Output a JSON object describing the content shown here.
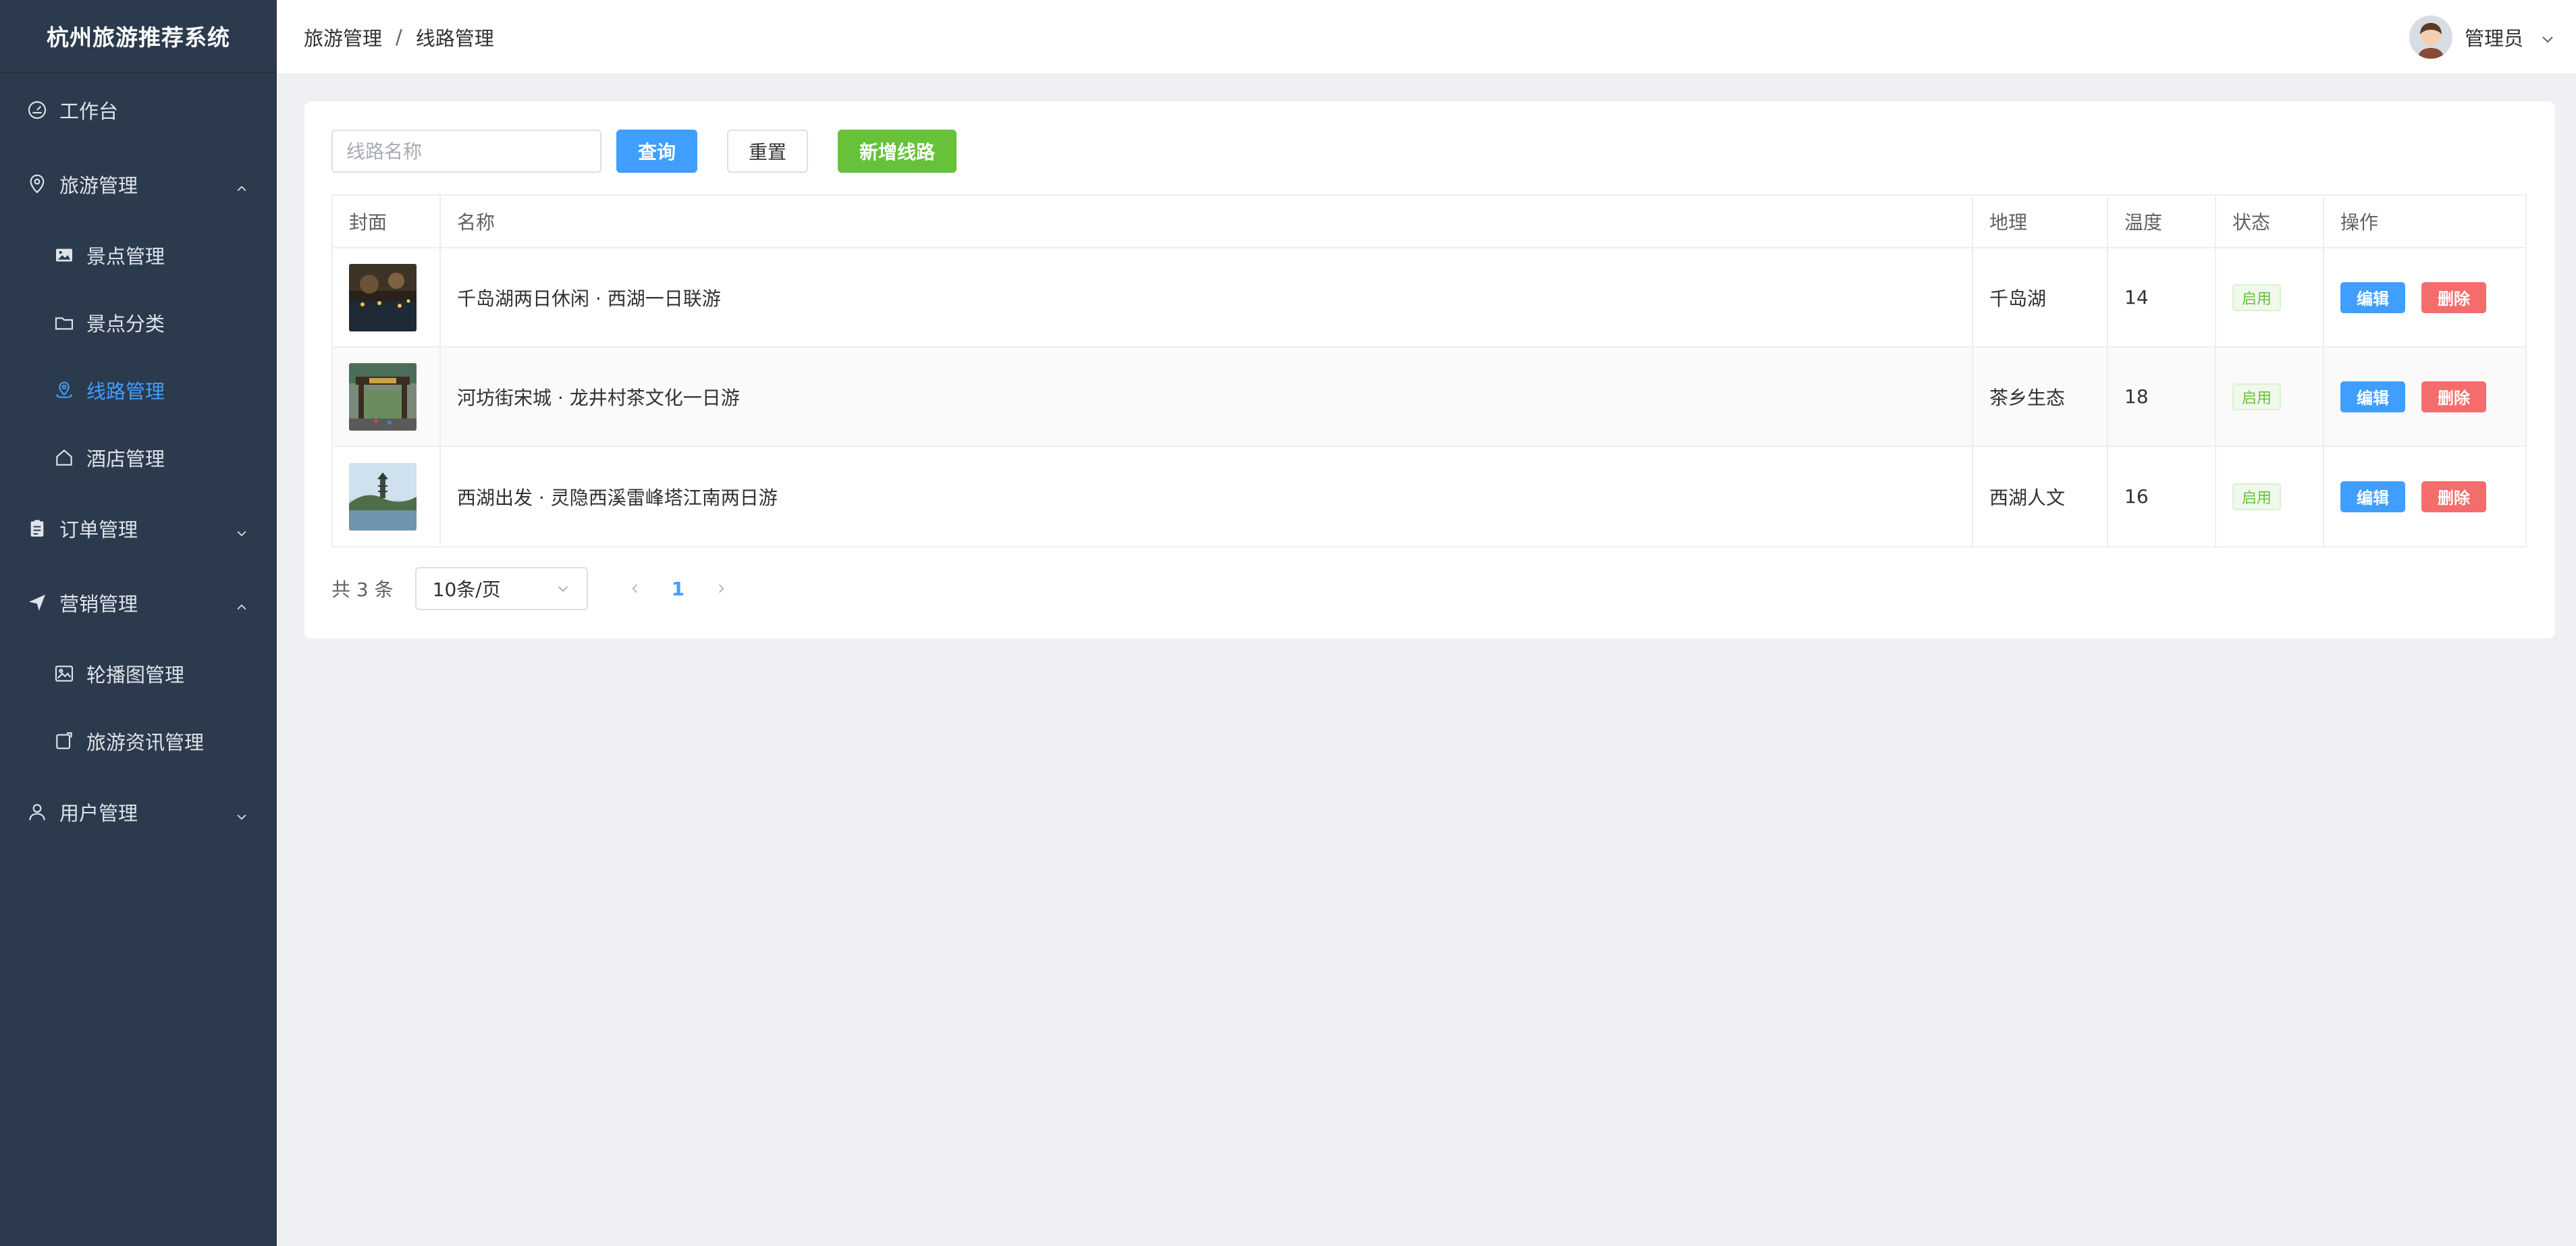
{
  "sidebar": {
    "brand": "杭州旅游推荐系统",
    "menu": {
      "workbench": "工作台",
      "travel": "旅游管理",
      "spots": "景点管理",
      "categories": "景点分类",
      "routes": "线路管理",
      "hotels": "酒店管理",
      "orders": "订单管理",
      "marketing": "营销管理",
      "carousel": "轮播图管理",
      "news": "旅游资讯管理",
      "users": "用户管理"
    },
    "active_color": "#409eff",
    "bg_color": "#2b3a4d"
  },
  "header": {
    "breadcrumb": [
      "旅游管理",
      "线路管理"
    ],
    "separator": "/",
    "user_name": "管理员"
  },
  "toolbar": {
    "search_placeholder": "线路名称",
    "search_value": "",
    "query_label": "查询",
    "reset_label": "重置",
    "add_label": "新增线路"
  },
  "table": {
    "columns": [
      "封面",
      "名称",
      "地理",
      "温度",
      "状态",
      "操作"
    ],
    "rows": [
      {
        "name": "千岛湖两日休闲 · 西湖一日联游",
        "geo": "千岛湖",
        "temp": "14",
        "status": "启用",
        "edit": "编辑",
        "delete": "删除"
      },
      {
        "name": "河坊街宋城 · 龙井村茶文化一日游",
        "geo": "茶乡生态",
        "temp": "18",
        "status": "启用",
        "edit": "编辑",
        "delete": "删除"
      },
      {
        "name": "西湖出发 · 灵隐西溪雷峰塔江南两日游",
        "geo": "西湖人文",
        "temp": "16",
        "status": "启用",
        "edit": "编辑",
        "delete": "删除"
      }
    ]
  },
  "pagination": {
    "total_text": "共 3 条",
    "page_size": "10条/页",
    "current_page": "1"
  },
  "colors": {
    "primary": "#409eff",
    "success": "#67c23a",
    "danger": "#f56c6c"
  }
}
